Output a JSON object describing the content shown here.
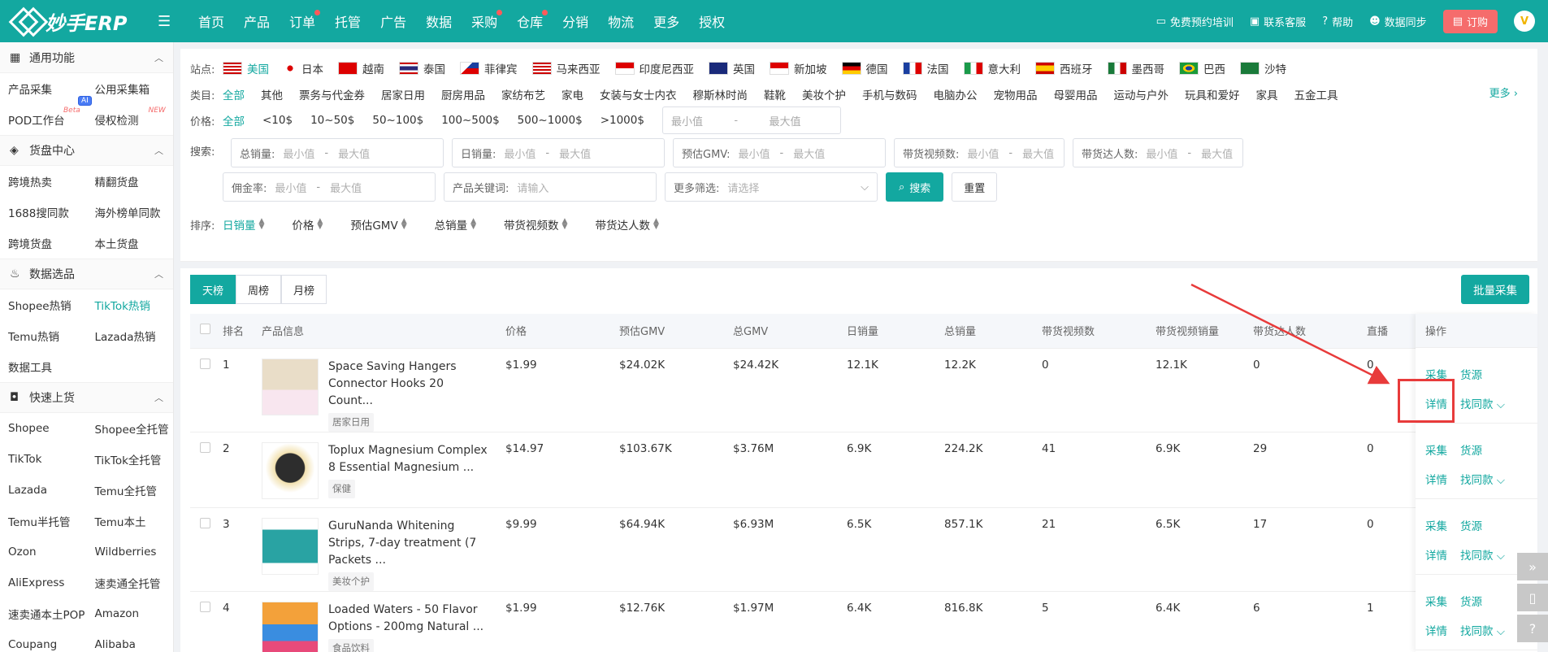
{
  "app": {
    "brand": "妙手ERP"
  },
  "nav": [
    "首页",
    "产品",
    "订单",
    "托管",
    "广告",
    "数据",
    "采购",
    "仓库",
    "分销",
    "物流",
    "更多",
    "授权"
  ],
  "top_right": {
    "training": "免费预约培训",
    "service": "联系客服",
    "help": "帮助",
    "sync": "数据同步",
    "order": "订购",
    "avatar": "V"
  },
  "sidebar": {
    "groups": [
      {
        "title": "通用功能",
        "icon": "grid-icon",
        "items": [
          "产品采集",
          "公用采集箱",
          "POD工作台",
          "侵权检测"
        ]
      },
      {
        "title": "货盘中心",
        "icon": "box-icon",
        "items": [
          "跨境热卖",
          "精翻货盘",
          "1688搜同款",
          "海外榜单同款",
          "跨境货盘",
          "本土货盘"
        ]
      },
      {
        "title": "数据选品",
        "icon": "fire-icon",
        "items": [
          "Shopee热销",
          "TikTok热销",
          "Temu热销",
          "Lazada热销",
          "数据工具"
        ]
      },
      {
        "title": "快速上货",
        "icon": "bag-icon",
        "items": [
          "Shopee",
          "Shopee全托管",
          "TikTok",
          "TikTok全托管",
          "Lazada",
          "Temu全托管",
          "Temu半托管",
          "Temu本土",
          "Ozon",
          "Wildberries",
          "AliExpress",
          "速卖通全托管",
          "速卖通本土POP",
          "Amazon",
          "Coupang",
          "Alibaba"
        ]
      }
    ],
    "tags": {
      "beta": "Beta",
      "new": "NEW",
      "ai": "AI"
    }
  },
  "filters": {
    "site_label": "站点:",
    "sites": [
      "美国",
      "日本",
      "越南",
      "泰国",
      "菲律宾",
      "马来西亚",
      "印度尼西亚",
      "英国",
      "新加坡",
      "德国",
      "法国",
      "意大利",
      "西班牙",
      "墨西哥",
      "巴西",
      "沙特"
    ],
    "category_label": "类目:",
    "categories": [
      "全部",
      "其他",
      "票务与代金券",
      "居家日用",
      "厨房用品",
      "家纺布艺",
      "家电",
      "女装与女士内衣",
      "穆斯林时尚",
      "鞋靴",
      "美妆个护",
      "手机与数码",
      "电脑办公",
      "宠物用品",
      "母婴用品",
      "运动与户外",
      "玩具和爱好",
      "家具",
      "五金工具"
    ],
    "more": "更多",
    "price_label": "价格:",
    "prices": [
      "全部",
      "<10$",
      "10~50$",
      "50~100$",
      "100~500$",
      "500~1000$",
      ">1000$"
    ],
    "min_ph": "最小值",
    "max_ph": "最大值",
    "search_label": "搜索:",
    "fields_row1": [
      "总销量:",
      "日销量:",
      "预估GMV:",
      "带货视频数:",
      "带货达人数:"
    ],
    "commission_label": "佣金率:",
    "keyword_label": "产品关键词:",
    "keyword_ph": "请输入",
    "more_filter_label": "更多筛选:",
    "more_filter_ph": "请选择",
    "search_btn": "搜索",
    "reset_btn": "重置",
    "sort_label": "排序:",
    "sorts": [
      "日销量",
      "价格",
      "预估GMV",
      "总销量",
      "带货视频数",
      "带货达人数"
    ]
  },
  "table": {
    "tabs": [
      "天榜",
      "周榜",
      "月榜"
    ],
    "batch_btn": "批量采集",
    "headers": [
      "排名",
      "产品信息",
      "价格",
      "预估GMV",
      "总GMV",
      "日销量",
      "总销量",
      "带货视频数",
      "带货视频销量",
      "带货达人数",
      "直播",
      "操作"
    ],
    "rows": [
      {
        "rank": "1",
        "name": "Space Saving Hangers Connector Hooks 20 Count...",
        "category": "居家日用",
        "price": "$1.99",
        "est_gmv": "$24.02K",
        "total_gmv": "$24.42K",
        "daily": "12.1K",
        "total": "12.2K",
        "videos": "0",
        "video_sales": "12.1K",
        "creators": "0",
        "live": "0"
      },
      {
        "rank": "2",
        "name": "Toplux Magnesium Complex 8 Essential Magnesium ...",
        "category": "保健",
        "price": "$14.97",
        "est_gmv": "$103.67K",
        "total_gmv": "$3.76M",
        "daily": "6.9K",
        "total": "224.2K",
        "videos": "41",
        "video_sales": "6.9K",
        "creators": "29",
        "live": "0"
      },
      {
        "rank": "3",
        "name": "GuruNanda Whitening Strips, 7-day treatment (7 Packets ...",
        "category": "美妆个护",
        "price": "$9.99",
        "est_gmv": "$64.94K",
        "total_gmv": "$6.93M",
        "daily": "6.5K",
        "total": "857.1K",
        "videos": "21",
        "video_sales": "6.5K",
        "creators": "17",
        "live": "0"
      },
      {
        "rank": "4",
        "name": "Loaded Waters - 50 Flavor Options - 200mg Natural ...",
        "category": "食品饮料",
        "price": "$1.99",
        "est_gmv": "$12.76K",
        "total_gmv": "$1.97M",
        "daily": "6.4K",
        "total": "816.8K",
        "videos": "5",
        "video_sales": "6.4K",
        "creators": "6",
        "live": "1"
      }
    ],
    "ops": {
      "collect": "采集",
      "source": "货源",
      "detail": "详情",
      "find_same": "找同款"
    }
  },
  "colors": {
    "primary": "#13a8a0",
    "highlight": "#e83b3b"
  }
}
